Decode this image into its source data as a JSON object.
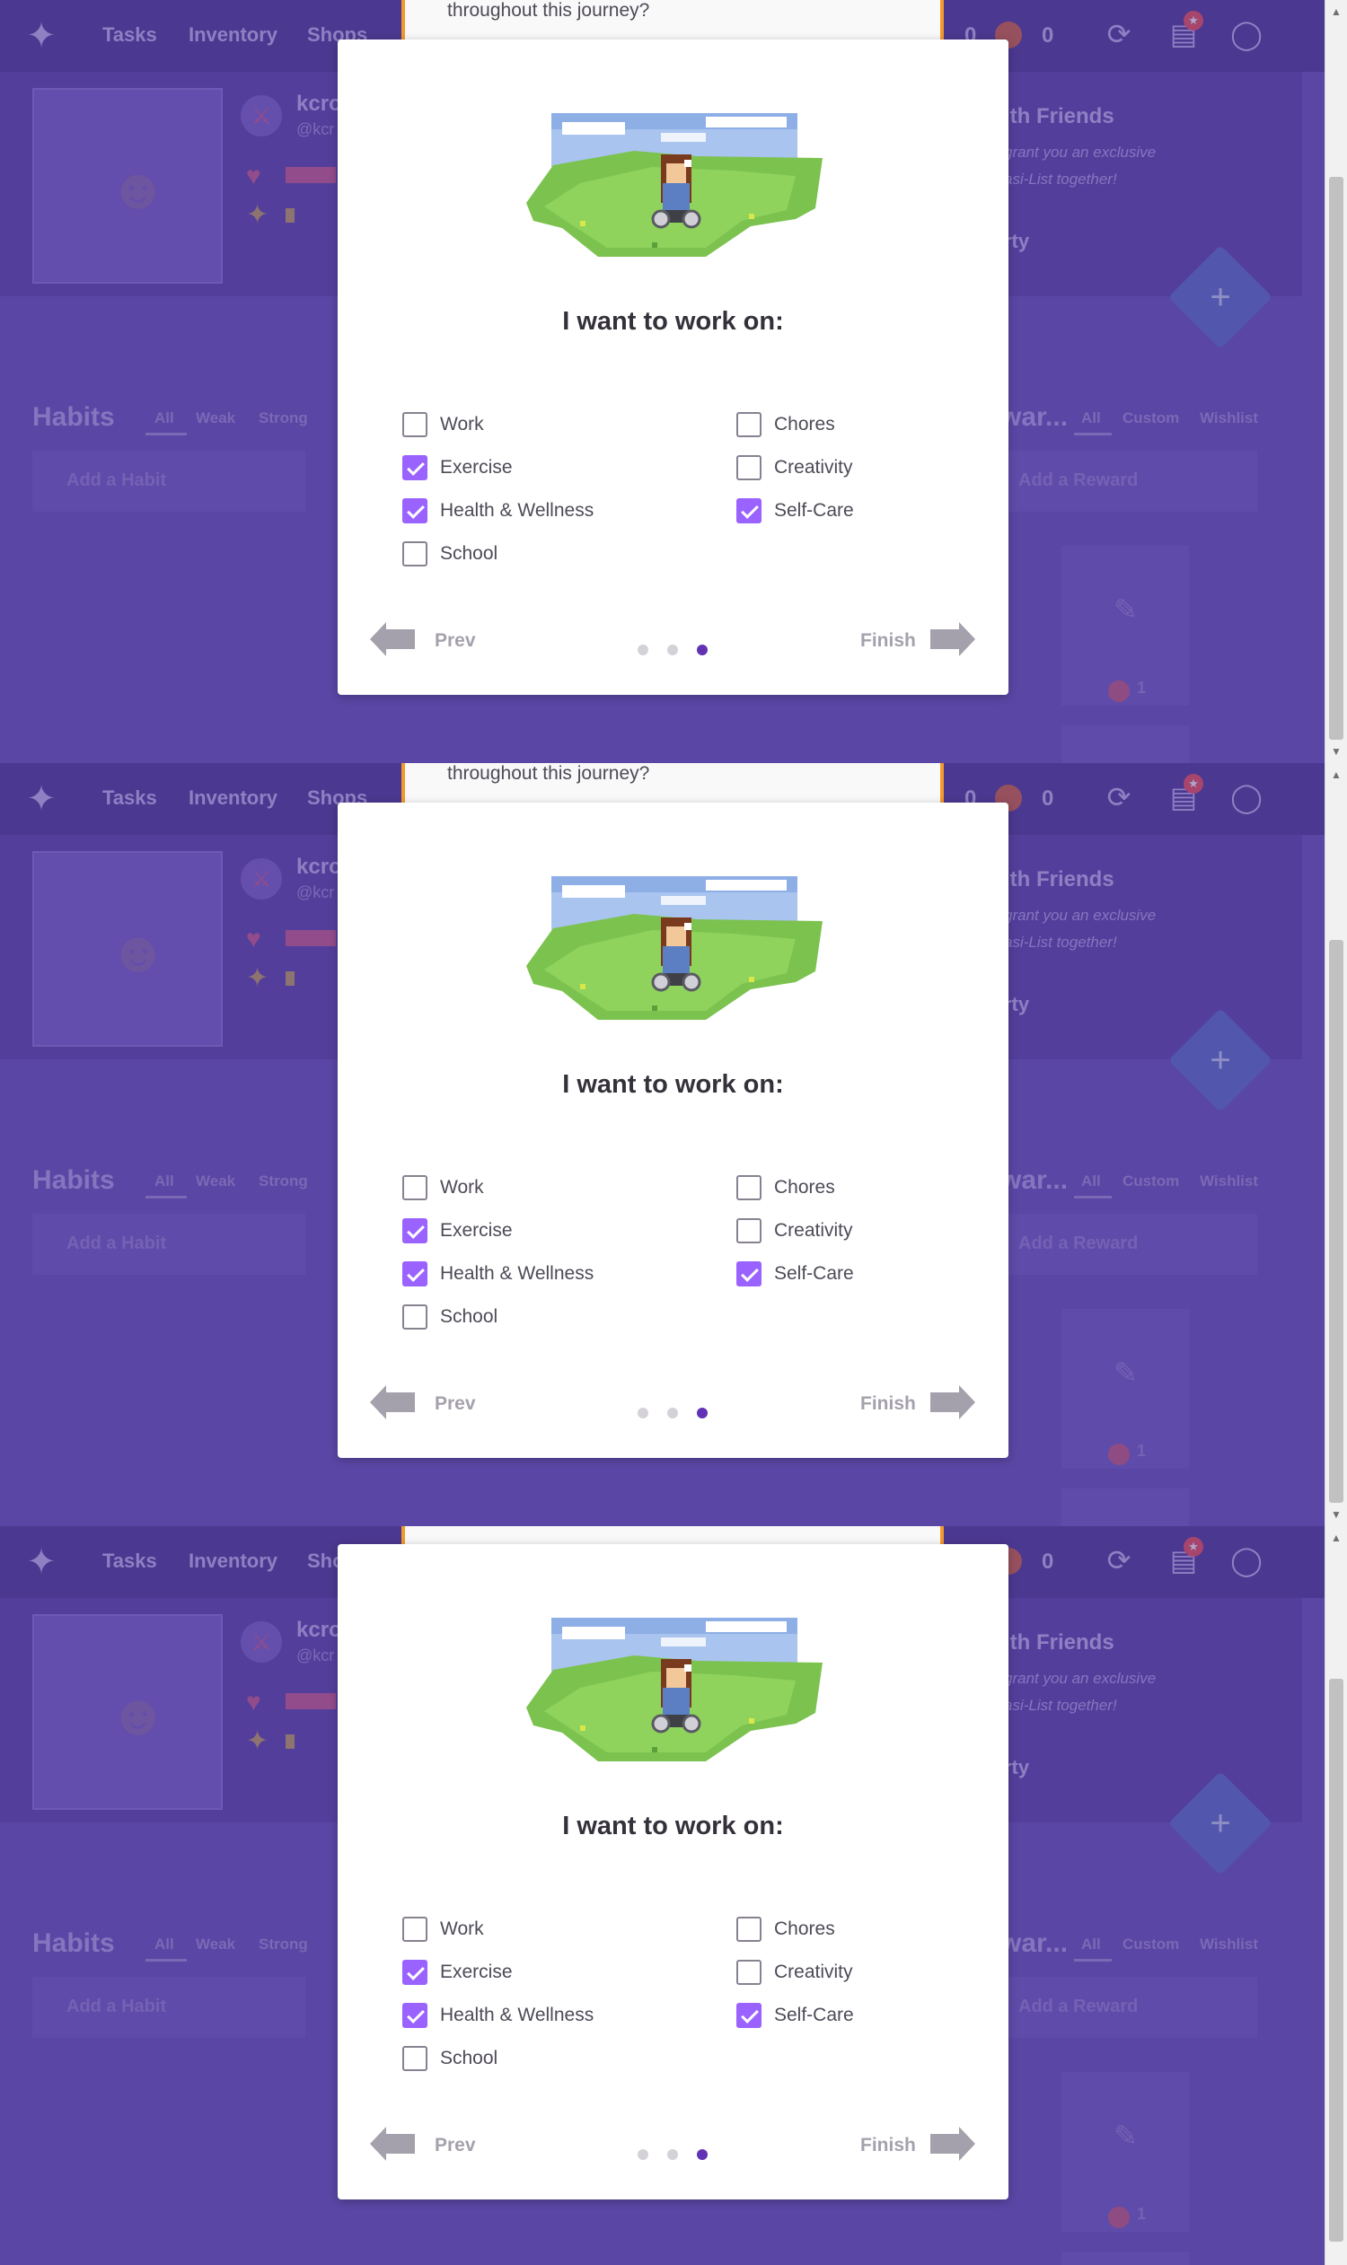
{
  "app": {
    "nav": [
      "Tasks",
      "Inventory",
      "Shops"
    ],
    "gold": "0",
    "gems": "0",
    "notification_count": "★",
    "username": "kcro",
    "handle": "@kcr",
    "party": {
      "title": "ith Friends",
      "line1": "grant you an exclusive",
      "line2": "asi-List together!",
      "cta": "rty"
    },
    "habits": {
      "title": "Habits",
      "filters": [
        "All",
        "Weak",
        "Strong"
      ],
      "add_placeholder": "Add a Habit"
    },
    "rewards": {
      "title": "war...",
      "filters": [
        "All",
        "Custom",
        "Wishlist"
      ],
      "add_placeholder": "Add a Reward",
      "item_cost": "1"
    }
  },
  "notice_text": "throughout this journey?",
  "modal": {
    "title": "I want to work on:",
    "options": [
      {
        "label": "Work",
        "checked": false
      },
      {
        "label": "Chores",
        "checked": false
      },
      {
        "label": "Exercise",
        "checked": true
      },
      {
        "label": "Creativity",
        "checked": false
      },
      {
        "label": "Health & Wellness",
        "checked": true
      },
      {
        "label": "Self-Care",
        "checked": true
      },
      {
        "label": "School",
        "checked": false
      }
    ],
    "prev_label": "Prev",
    "next_label": "Finish",
    "pages": 3,
    "current_page": 3
  },
  "colors": {
    "accent_purple": "#9a62ff",
    "active_dot": "#6133b4",
    "notice_border": "#f29a2e"
  }
}
